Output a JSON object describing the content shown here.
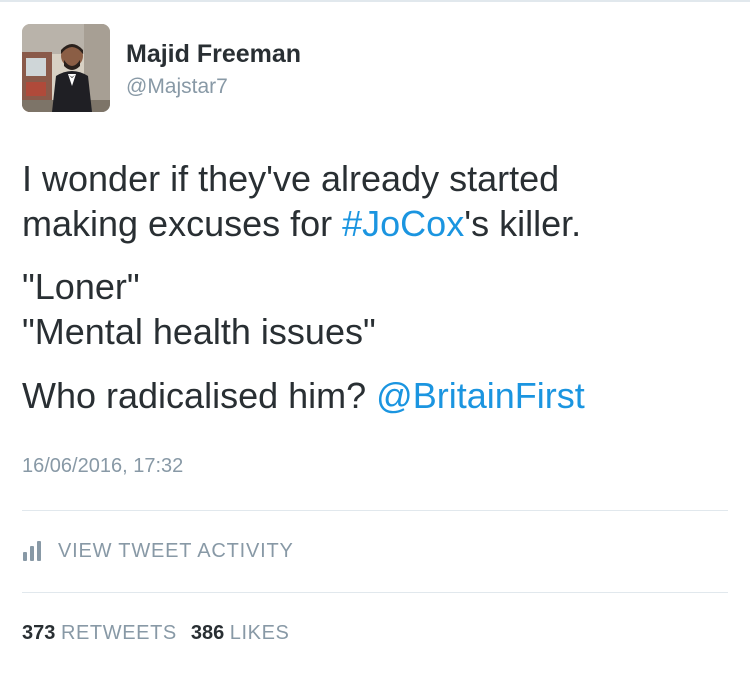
{
  "author": {
    "name": "Majid Freeman",
    "handle": "@Majstar7"
  },
  "tweet": {
    "line1": "I wonder if they've already started",
    "line2_prefix": "making excuses for ",
    "line2_hashtag": "#JoCox",
    "line2_suffix": "'s killer.",
    "line3": "\"Loner\"",
    "line4": "\"Mental health issues\"",
    "line5_prefix": "Who radicalised him? ",
    "line5_mention": "@BritainFirst",
    "timestamp": "16/06/2016, 17:32"
  },
  "activity": {
    "label": "VIEW TWEET ACTIVITY",
    "icon": "bar-chart-icon"
  },
  "stats": {
    "retweets_count": "373",
    "retweets_label": "RETWEETS",
    "likes_count": "386",
    "likes_label": "LIKES"
  },
  "colors": {
    "link": "#1b95e0",
    "muted": "#8899a6",
    "text": "#292f33",
    "divider": "#e1e8ed"
  }
}
